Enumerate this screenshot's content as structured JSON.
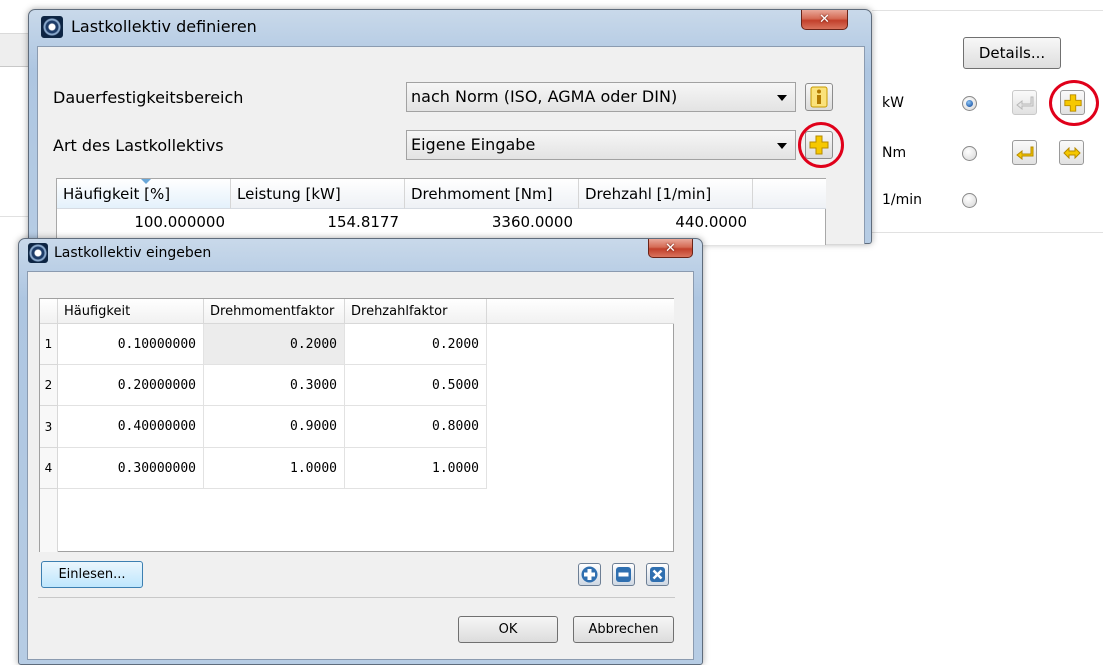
{
  "main_dialog": {
    "title": "Lastkollektiv definieren",
    "close_symbol": "✕",
    "dauerfestigkeit_label": "Dauerfestigkeitsbereich",
    "dauerfestigkeit_value": "nach Norm (ISO, AGMA oder DIN)",
    "art_label": "Art des Lastkollektivs",
    "art_value": "Eigene Eingabe",
    "info_icon": "info-icon",
    "table": {
      "columns": [
        "Häufigkeit [%]",
        "Leistung [kW]",
        "Drehmoment [Nm]",
        "Drehzahl [1/min]"
      ],
      "row": [
        "100.000000",
        "154.8177",
        "3360.0000",
        "440.0000"
      ]
    }
  },
  "side_panel": {
    "details_label": "Details...",
    "units": [
      {
        "label": "kW",
        "selected": true
      },
      {
        "label": "Nm",
        "selected": false
      },
      {
        "label": "1/min",
        "selected": false
      }
    ]
  },
  "sub_dialog": {
    "title": "Lastkollektiv eingeben",
    "close_symbol": "✕",
    "columns": [
      "Häufigkeit",
      "Drehmomentfaktor",
      "Drehzahlfaktor"
    ],
    "rows": [
      {
        "index": "1",
        "values": [
          "0.10000000",
          "0.2000",
          "0.2000"
        ]
      },
      {
        "index": "2",
        "values": [
          "0.20000000",
          "0.3000",
          "0.5000"
        ]
      },
      {
        "index": "3",
        "values": [
          "0.40000000",
          "0.9000",
          "0.8000"
        ]
      },
      {
        "index": "4",
        "values": [
          "0.30000000",
          "1.0000",
          "1.0000"
        ]
      }
    ],
    "einlesen_label": "Einlesen...",
    "ok_label": "OK",
    "cancel_label": "Abbrechen"
  },
  "colors": {
    "highlight_ring": "#e0001a",
    "plus_icon": "#f2c200",
    "blue_plus": "#2f6fb0"
  }
}
